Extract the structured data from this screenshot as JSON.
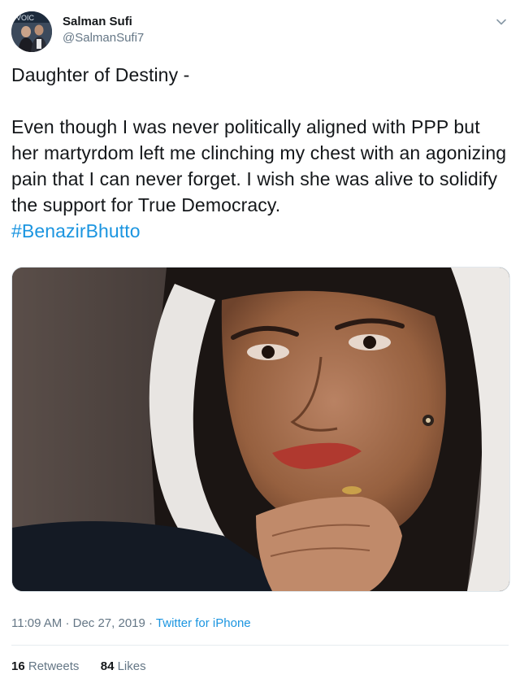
{
  "author": {
    "name": "Salman Sufi",
    "handle": "@SalmanSufi7",
    "avatar_banner_text": "VOIC"
  },
  "tweet": {
    "line1": "Daughter of Destiny -",
    "body": "Even though I was never politically aligned with PPP but her martyrdom left me clinching my chest with an agonizing pain that I can never forget. I wish she was alive to solidify the support for True Democracy.",
    "hashtag": "#BenazirBhutto"
  },
  "meta": {
    "time": "11:09 AM",
    "separator": "·",
    "date": "Dec 27, 2019",
    "source": "Twitter for iPhone"
  },
  "stats": {
    "retweets_count": "16",
    "retweets_label": "Retweets",
    "likes_count": "84",
    "likes_label": "Likes"
  },
  "colors": {
    "link": "#1b95e0",
    "secondary_text": "#657786",
    "primary_text": "#14171a"
  },
  "icons": {
    "menu": "chevron-down-icon"
  }
}
